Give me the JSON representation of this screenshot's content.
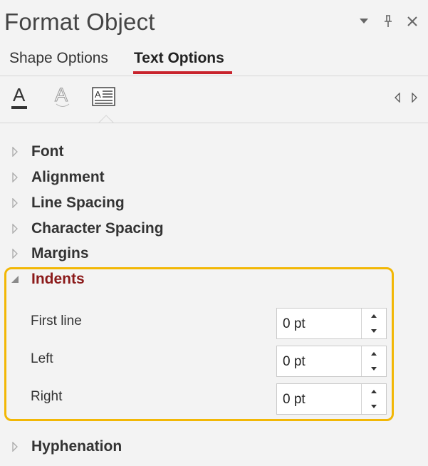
{
  "header": {
    "title": "Format Object",
    "dropdown_icon": "chevron-down-icon",
    "pin_icon": "pin-icon",
    "close_icon": "close-icon"
  },
  "tabs": [
    {
      "label": "Shape Options",
      "active": false
    },
    {
      "label": "Text Options",
      "active": true
    }
  ],
  "icon_tabs": [
    {
      "name": "text-fill-outline-icon",
      "active": false
    },
    {
      "name": "text-effects-icon",
      "active": false
    },
    {
      "name": "textbox-icon",
      "active": true
    }
  ],
  "sections": {
    "font": "Font",
    "alignment": "Alignment",
    "line_spacing": "Line Spacing",
    "character_spacing": "Character Spacing",
    "margins": "Margins",
    "indents": "Indents",
    "hyphenation": "Hyphenation"
  },
  "indents": {
    "first_line": {
      "label": "First line",
      "value": "0 pt"
    },
    "left": {
      "label": "Left",
      "value": "0 pt"
    },
    "right": {
      "label": "Right",
      "value": "0 pt"
    }
  },
  "colors": {
    "accent": "#c8232c",
    "active_section": "#8b1a1a",
    "highlight": "#f2b705",
    "background": "#f3f3f3"
  }
}
